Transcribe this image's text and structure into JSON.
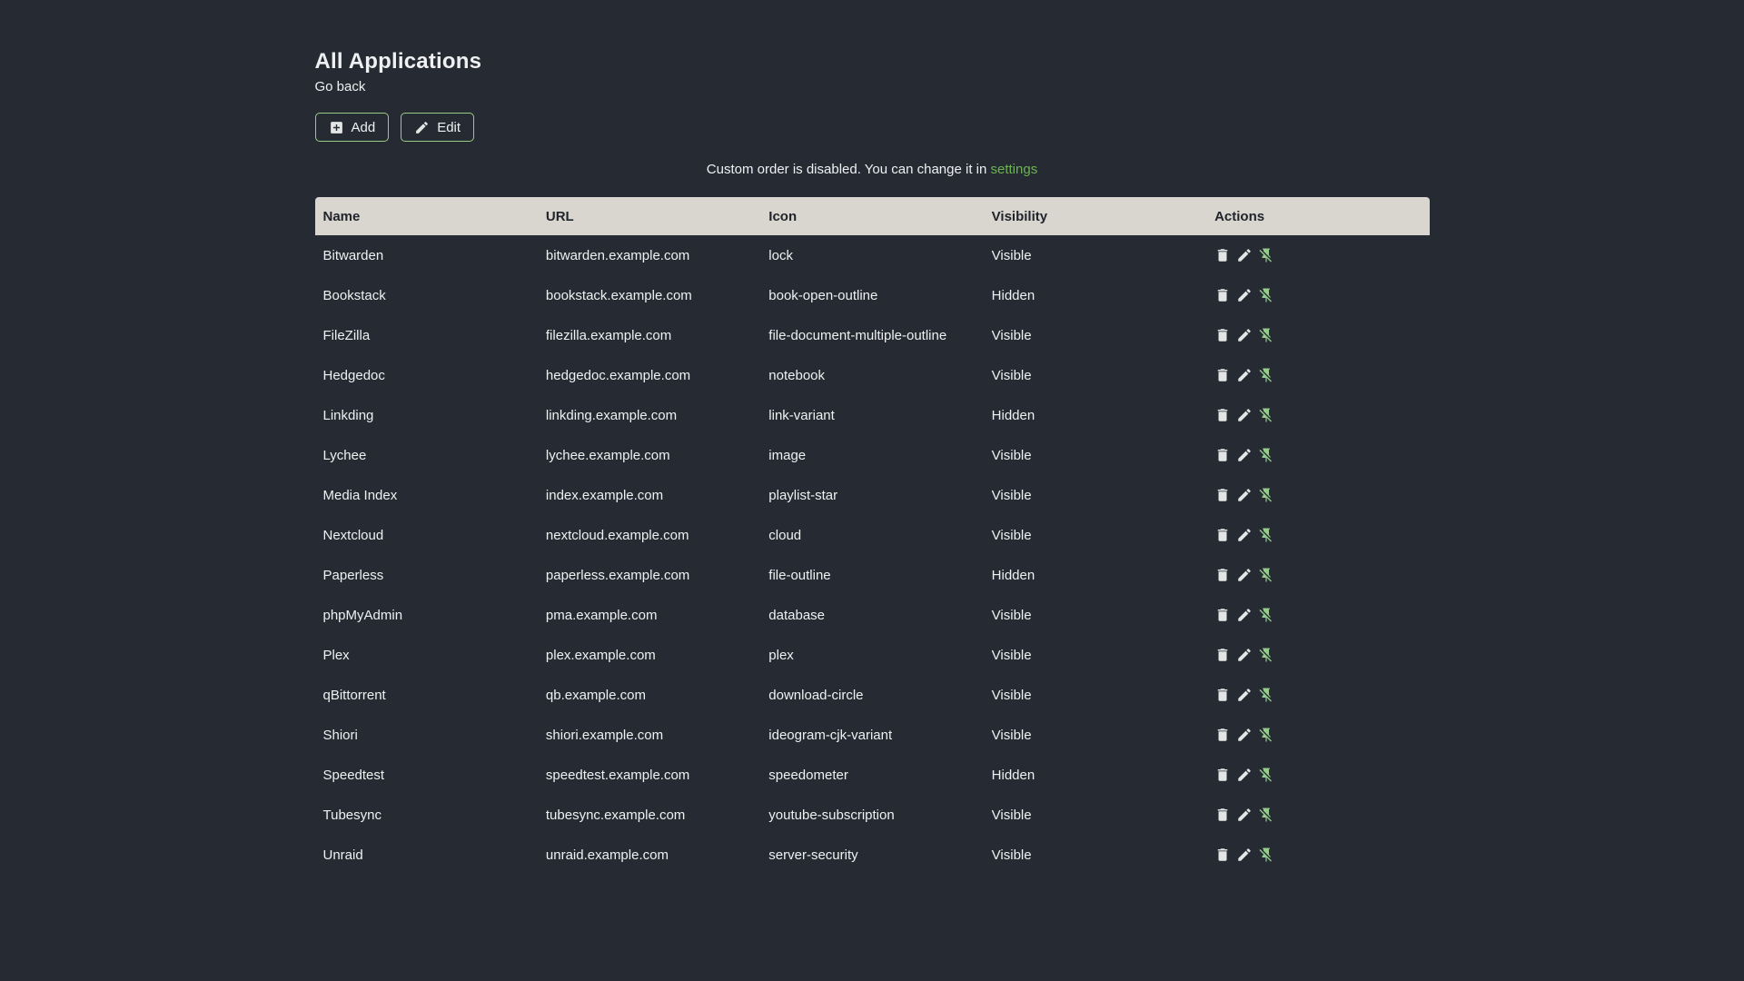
{
  "page": {
    "title": "All Applications",
    "back_link": "Go back"
  },
  "toolbar": {
    "add_label": "Add",
    "add_icon": "plus-box-icon",
    "edit_label": "Edit",
    "edit_icon": "pencil-icon"
  },
  "notice": {
    "text": "Custom order is disabled. You can change it in",
    "link": "settings"
  },
  "table": {
    "headers": [
      "Name",
      "URL",
      "Icon",
      "Visibility",
      "Actions"
    ],
    "action_icons": [
      "delete-icon",
      "pencil-icon",
      "pin-off-icon"
    ],
    "rows": [
      {
        "name": "Bitwarden",
        "url": "bitwarden.example.com",
        "icon": "lock",
        "visibility": "Visible"
      },
      {
        "name": "Bookstack",
        "url": "bookstack.example.com",
        "icon": "book-open-outline",
        "visibility": "Hidden"
      },
      {
        "name": "FileZilla",
        "url": "filezilla.example.com",
        "icon": "file-document-multiple-outline",
        "visibility": "Visible"
      },
      {
        "name": "Hedgedoc",
        "url": "hedgedoc.example.com",
        "icon": "notebook",
        "visibility": "Visible"
      },
      {
        "name": "Linkding",
        "url": "linkding.example.com",
        "icon": "link-variant",
        "visibility": "Hidden"
      },
      {
        "name": "Lychee",
        "url": "lychee.example.com",
        "icon": "image",
        "visibility": "Visible"
      },
      {
        "name": "Media Index",
        "url": "index.example.com",
        "icon": "playlist-star",
        "visibility": "Visible"
      },
      {
        "name": "Nextcloud",
        "url": "nextcloud.example.com",
        "icon": "cloud",
        "visibility": "Visible"
      },
      {
        "name": "Paperless",
        "url": "paperless.example.com",
        "icon": "file-outline",
        "visibility": "Hidden"
      },
      {
        "name": "phpMyAdmin",
        "url": "pma.example.com",
        "icon": "database",
        "visibility": "Visible"
      },
      {
        "name": "Plex",
        "url": "plex.example.com",
        "icon": "plex",
        "visibility": "Visible"
      },
      {
        "name": "qBittorrent",
        "url": "qb.example.com",
        "icon": "download-circle",
        "visibility": "Visible"
      },
      {
        "name": "Shiori",
        "url": "shiori.example.com",
        "icon": "ideogram-cjk-variant",
        "visibility": "Visible"
      },
      {
        "name": "Speedtest",
        "url": "speedtest.example.com",
        "icon": "speedometer",
        "visibility": "Hidden"
      },
      {
        "name": "Tubesync",
        "url": "tubesync.example.com",
        "icon": "youtube-subscription",
        "visibility": "Visible"
      },
      {
        "name": "Unraid",
        "url": "unraid.example.com",
        "icon": "server-security",
        "visibility": "Visible"
      }
    ]
  },
  "colors": {
    "background": "#262b33",
    "text": "#eff0f1",
    "accent_green": "#6db253",
    "pin_green": "#94ca8c",
    "button_border": "#9acb86",
    "icon_light": "#e4e6e6",
    "table_header_bg": "#d9d6d0",
    "table_header_text": "#20242b"
  }
}
